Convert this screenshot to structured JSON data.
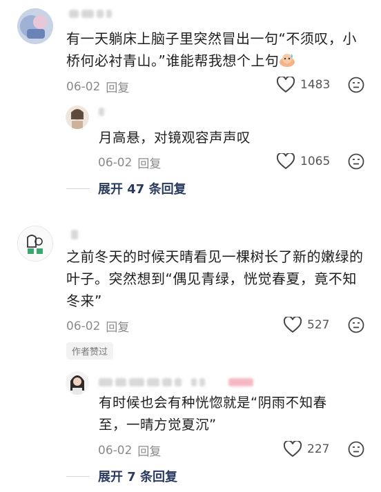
{
  "comments": [
    {
      "text": "有一天躺床上脑子里突然冒出一句“不须叹，小桥何必衬青山。”谁能帮我想个上句",
      "date": "06-02",
      "reply_label": "回复",
      "likes": "1483",
      "replies": [
        {
          "text": "月高悬，对镜观容声声叹",
          "date": "06-02",
          "reply_label": "回复",
          "likes": "1065"
        }
      ],
      "expand_label": "展开 47 条回复"
    },
    {
      "text": "之前冬天的时候天晴看见一棵树长了新的嫩绿的叶子。突然想到“偶见青绿，恍觉春夏，竟不知冬来”",
      "date": "06-02",
      "reply_label": "回复",
      "likes": "527",
      "author_badge": "作者赞过",
      "replies": [
        {
          "text": "有时候也会有种恍惚就是“阴雨不知春至，一晴方觉夏沉”",
          "date": "06-02",
          "reply_label": "回复",
          "likes": "227"
        }
      ],
      "expand_label": "展开 7 条回复"
    }
  ],
  "icons": {
    "like": "heart-outline-icon",
    "dislike": "meh-face-icon",
    "emoji": "sweat-emoji-icon"
  },
  "colors": {
    "text": "#1e1e1e",
    "meta": "#8a8a8a",
    "expand": "#2a3b60",
    "badge_bg": "#f2f2f2"
  }
}
